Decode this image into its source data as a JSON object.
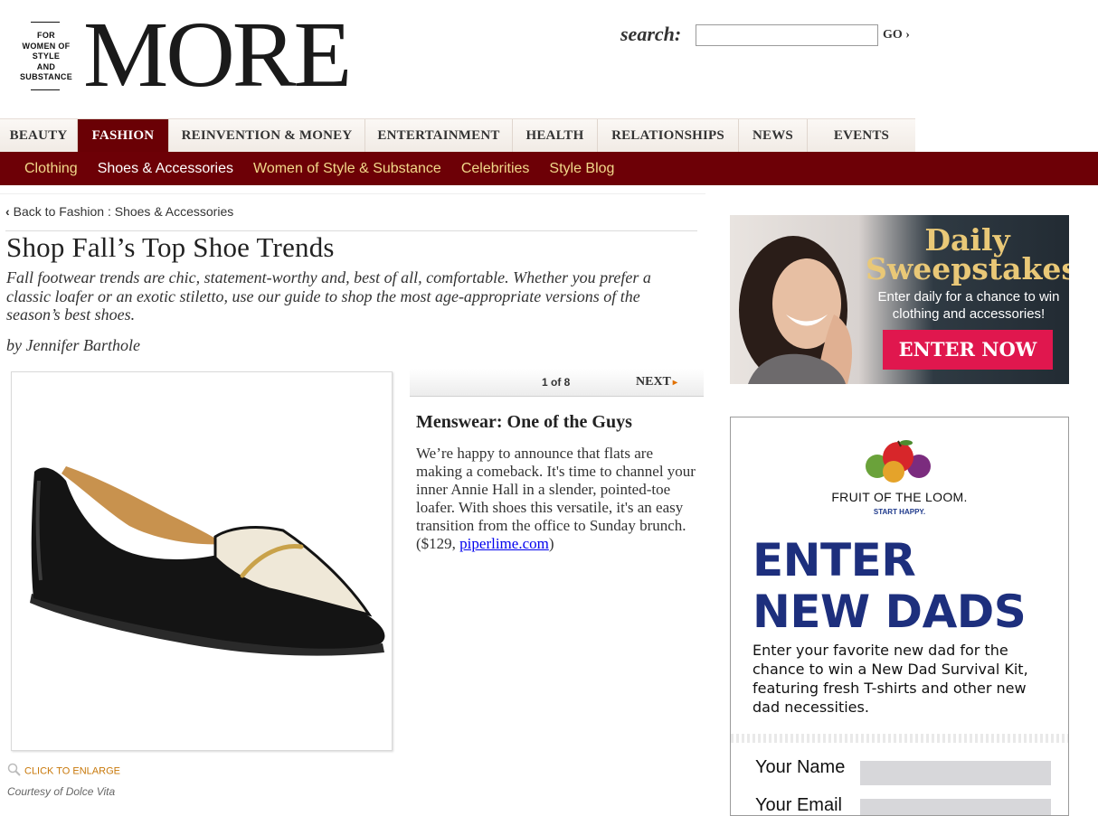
{
  "header": {
    "tagline": [
      "FOR",
      "WOMEN OF",
      "STYLE",
      "AND",
      "SUBSTANCE"
    ],
    "logo": "MORE",
    "search": {
      "label": "search:",
      "value": "",
      "go_label": "GO ›"
    }
  },
  "primary_nav": [
    {
      "label": "BEAUTY",
      "active": false
    },
    {
      "label": "FASHION",
      "active": true
    },
    {
      "label": "REINVENTION & MONEY",
      "active": false
    },
    {
      "label": "ENTERTAINMENT",
      "active": false
    },
    {
      "label": "HEALTH",
      "active": false
    },
    {
      "label": "RELATIONSHIPS",
      "active": false
    },
    {
      "label": "NEWS",
      "active": false
    },
    {
      "label": "EVENTS",
      "active": false
    }
  ],
  "secondary_nav": [
    {
      "label": "Clothing",
      "active": false
    },
    {
      "label": "Shoes & Accessories",
      "active": true
    },
    {
      "label": "Women of Style & Substance",
      "active": false
    },
    {
      "label": "Celebrities",
      "active": false
    },
    {
      "label": "Style Blog",
      "active": false
    }
  ],
  "article": {
    "back_link": "Back to Fashion : Shoes & Accessories",
    "title": "Shop Fall’s Top Shoe Trends",
    "deck": "Fall footwear trends are chic, statement-worthy and, best of all, comfortable. Whether you prefer a classic loafer or an exotic stiletto, use our guide to shop the most age-appropriate versions of the season’s best shoes.",
    "byline": "by Jennifer Barthole",
    "click_to_enlarge": "CLICK TO ENLARGE",
    "courtesy": "Courtesy of Dolce Vita"
  },
  "slideshow": {
    "counter": "1 of 8",
    "next_label": "NEXT",
    "slide_title": "Menswear: One of the Guys",
    "slide_body": "We’re happy to announce that flats are making a comeback. It's time to channel your inner Annie Hall in a slender, pointed-toe loafer. With shoes this versatile, it's an easy transition from the office to Sunday brunch. ($129, ",
    "slide_link": "piperlime.com",
    "slide_body_end": ")"
  },
  "ads": {
    "sweepstakes": {
      "title_line1": "Daily",
      "title_line2": "Sweepstakes",
      "subtitle": "Enter daily for a chance to win clothing and accessories!",
      "button": "ENTER NOW"
    },
    "fotl": {
      "brand": "FRUIT OF THE LOOM.",
      "tagline": "START HAPPY.",
      "headline_line1": "ENTER",
      "headline_line2": "NEW DADS",
      "body": "Enter your favorite new dad for the chance to win a New Dad Survival Kit, featuring fresh T-shirts and other new dad necessities.",
      "field_name_label": "Your Name",
      "field_email_label": "Your Email"
    }
  },
  "colors": {
    "nav_active_bg": "#6a0005",
    "secondary_nav_bg": "#6d0006",
    "secondary_nav_text": "#f1d88a",
    "sweeps_button": "#e0174e",
    "fotl_blue": "#1d2f7d"
  }
}
